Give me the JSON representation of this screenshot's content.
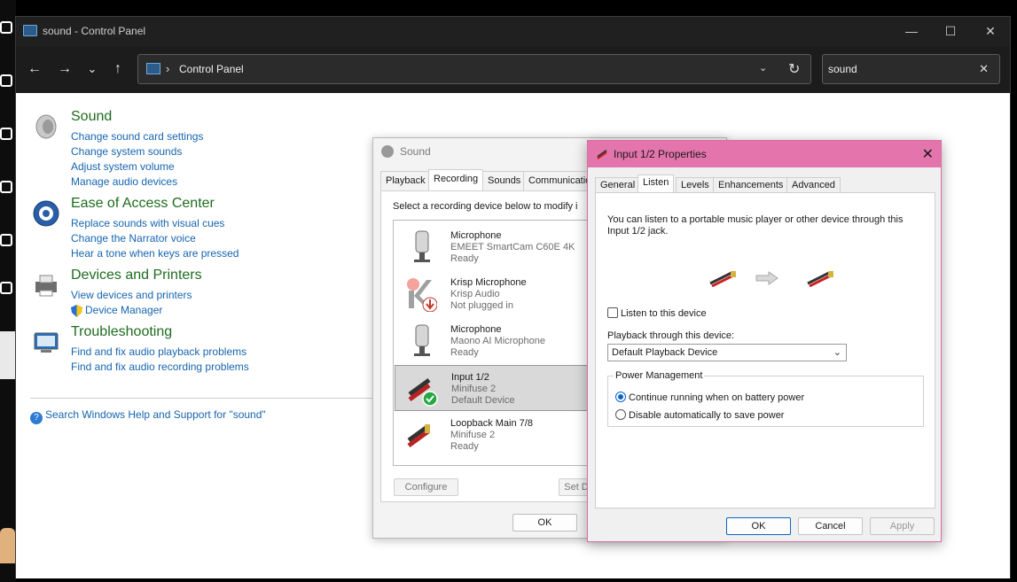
{
  "window": {
    "title": "sound - Control Panel",
    "minimize": "—",
    "maximize": "☐",
    "close": "✕"
  },
  "nav": {
    "back": "←",
    "forward": "→",
    "recent": "⌄",
    "up": "↑",
    "address": "Control Panel",
    "search_value": "sound"
  },
  "results": [
    {
      "title": "Sound",
      "icon": "speaker-icon",
      "links": [
        "Change sound card settings",
        "Change system sounds",
        "Adjust system volume",
        "Manage audio devices"
      ]
    },
    {
      "title": "Ease of Access Center",
      "icon": "ease-of-access-icon",
      "links": [
        "Replace sounds with visual cues",
        "Change the Narrator voice",
        "Hear a tone when keys are pressed"
      ]
    },
    {
      "title": "Devices and Printers",
      "icon": "printer-icon",
      "links": [
        "View devices and printers",
        "Device Manager"
      ]
    },
    {
      "title": "Troubleshooting",
      "icon": "troubleshoot-icon",
      "links": [
        "Find and fix audio playback problems",
        "Find and fix audio recording problems"
      ]
    }
  ],
  "help_link": "Search Windows Help and Support for \"sound\"",
  "sound_dialog": {
    "title": "Sound",
    "tabs": [
      "Playback",
      "Recording",
      "Sounds",
      "Communicatio"
    ],
    "active_tab": "Recording",
    "instruction": "Select a recording device below to modify i",
    "devices": [
      {
        "name": "Microphone",
        "desc": "EMEET SmartCam C60E 4K",
        "status": "Ready",
        "icon": "microphone-icon",
        "selected": false
      },
      {
        "name": "Krisp Microphone",
        "desc": "Krisp Audio",
        "status": "Not plugged in",
        "icon": "krisp-icon",
        "selected": false
      },
      {
        "name": "Microphone",
        "desc": "Maono AI Microphone",
        "status": "Ready",
        "icon": "microphone-icon",
        "selected": false
      },
      {
        "name": "Input 1/2",
        "desc": "Minifuse 2",
        "status": "Default Device",
        "icon": "rca-cable-icon",
        "selected": true
      },
      {
        "name": "Loopback Main 7/8",
        "desc": "Minifuse 2",
        "status": "Ready",
        "icon": "rca-cable-icon",
        "selected": false
      }
    ],
    "configure": "Configure",
    "set_default": "Set D",
    "ok": "OK"
  },
  "prop_dialog": {
    "title": "Input 1/2 Properties",
    "close": "✕",
    "tabs": [
      "General",
      "Listen",
      "Levels",
      "Enhancements",
      "Advanced"
    ],
    "active_tab": "Listen",
    "description": "You can listen to a portable music player or other device through this Input 1/2 jack.",
    "listen_checkbox": "Listen to this device",
    "listen_checked": false,
    "playback_label": "Playback through this device:",
    "playback_value": "Default Playback Device",
    "power_legend": "Power Management",
    "radio_continue": "Continue running when on battery power",
    "radio_disable": "Disable automatically to save power",
    "selected_power": "continue",
    "ok": "OK",
    "cancel": "Cancel",
    "apply": "Apply"
  },
  "colors": {
    "titlebar_dark": "#202020",
    "link_blue": "#1665b0",
    "category_green": "#1e6c1e",
    "prop_title_pink": "#e474ac",
    "accent": "#0a64c8"
  }
}
